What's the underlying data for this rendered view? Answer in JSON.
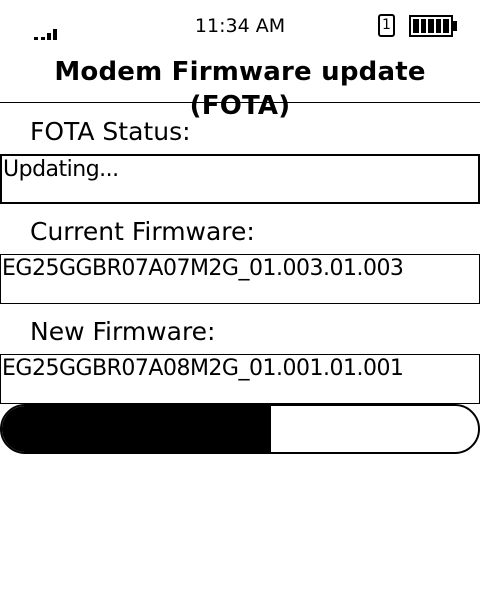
{
  "status_bar": {
    "time": "11:34 AM",
    "sim_slot": "1",
    "signal_icon": "signal-strength-icon",
    "battery_icon": "battery-full-icon"
  },
  "title": "Modem Firmware update (FOTA)",
  "fota_status": {
    "label": "FOTA Status:",
    "value": "Updating..."
  },
  "current_firmware": {
    "label": "Current Firmware:",
    "value": "EG25GGBR07A07M2G_01.003.01.003"
  },
  "new_firmware": {
    "label": "New Firmware:",
    "value": "EG25GGBR07A08M2G_01.001.01.001"
  },
  "progress": {
    "fraction": 0.565
  }
}
